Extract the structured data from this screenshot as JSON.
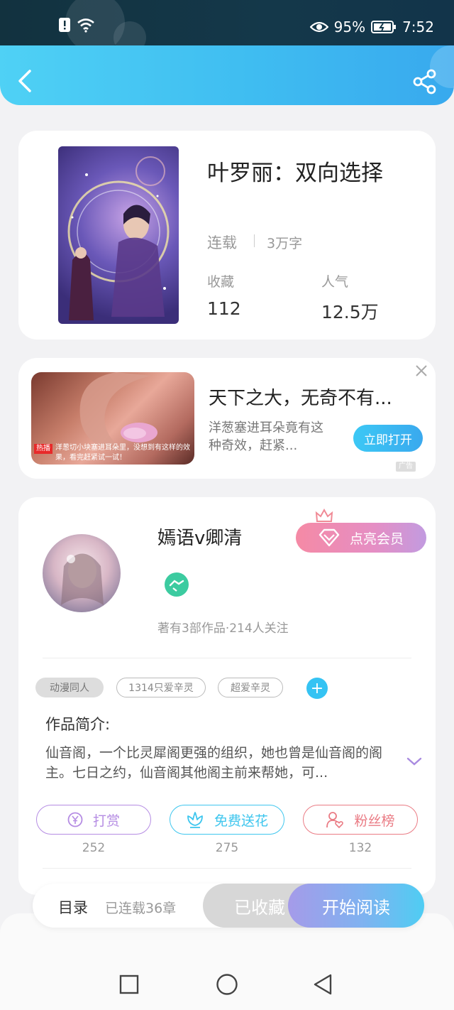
{
  "status_bar": {
    "battery": "95%",
    "time": "7:52"
  },
  "book": {
    "title": "叶罗丽：双向选择",
    "status": "连载",
    "word_count": "3万字",
    "favorites_label": "收藏",
    "favorites_value": "112",
    "popularity_label": "人气",
    "popularity_value": "12.5万"
  },
  "ad": {
    "title": "天下之大，无奇不有...",
    "desc": "洋葱塞进耳朵竟有这种奇效，赶紧...",
    "button": "立即打开",
    "badge": "广告",
    "image_hot_tag": "热播",
    "image_caption": "洋葱切小块塞进耳朵里，没想到有这样的效果，看完赶紧试一试！"
  },
  "author": {
    "name": "嫣语v卿清",
    "vip_button": "点亮会员",
    "stats": "著有3部作品·214人关注"
  },
  "tags": [
    "动漫同人",
    "1314只爱辛灵",
    "超爱辛灵"
  ],
  "intro": {
    "label": "作品简介:",
    "text": "仙音阁，一个比灵犀阁更强的组织，她也曾是仙音阁的阁主。七日之约，仙音阁其他阁主前来帮她，可..."
  },
  "actions": {
    "reward_label": "打赏",
    "reward_count": "252",
    "flower_label": "免费送花",
    "flower_count": "275",
    "fans_label": "粉丝榜",
    "fans_count": "132"
  },
  "bottom": {
    "toc_label": "目录",
    "toc_info": "已连载36章",
    "collected": "已收藏",
    "read": "开始阅读"
  },
  "colors": {
    "header_start": "#4fd1f5",
    "header_end": "#38a9ee",
    "reward": "#b58ce3",
    "flower": "#3ec6ee",
    "fans": "#ea7b84",
    "vip_start": "#f58aa5",
    "vip_end": "#c29be0"
  },
  "icons": {
    "back": "chevron-left-icon",
    "share": "share-icon",
    "close": "close-icon",
    "diamond": "diamond-icon",
    "crown": "crown-icon",
    "add": "plus-icon",
    "expand": "chevron-down-icon",
    "reward": "yen-coin-icon",
    "flower": "flower-icon",
    "fans": "user-heart-icon"
  }
}
